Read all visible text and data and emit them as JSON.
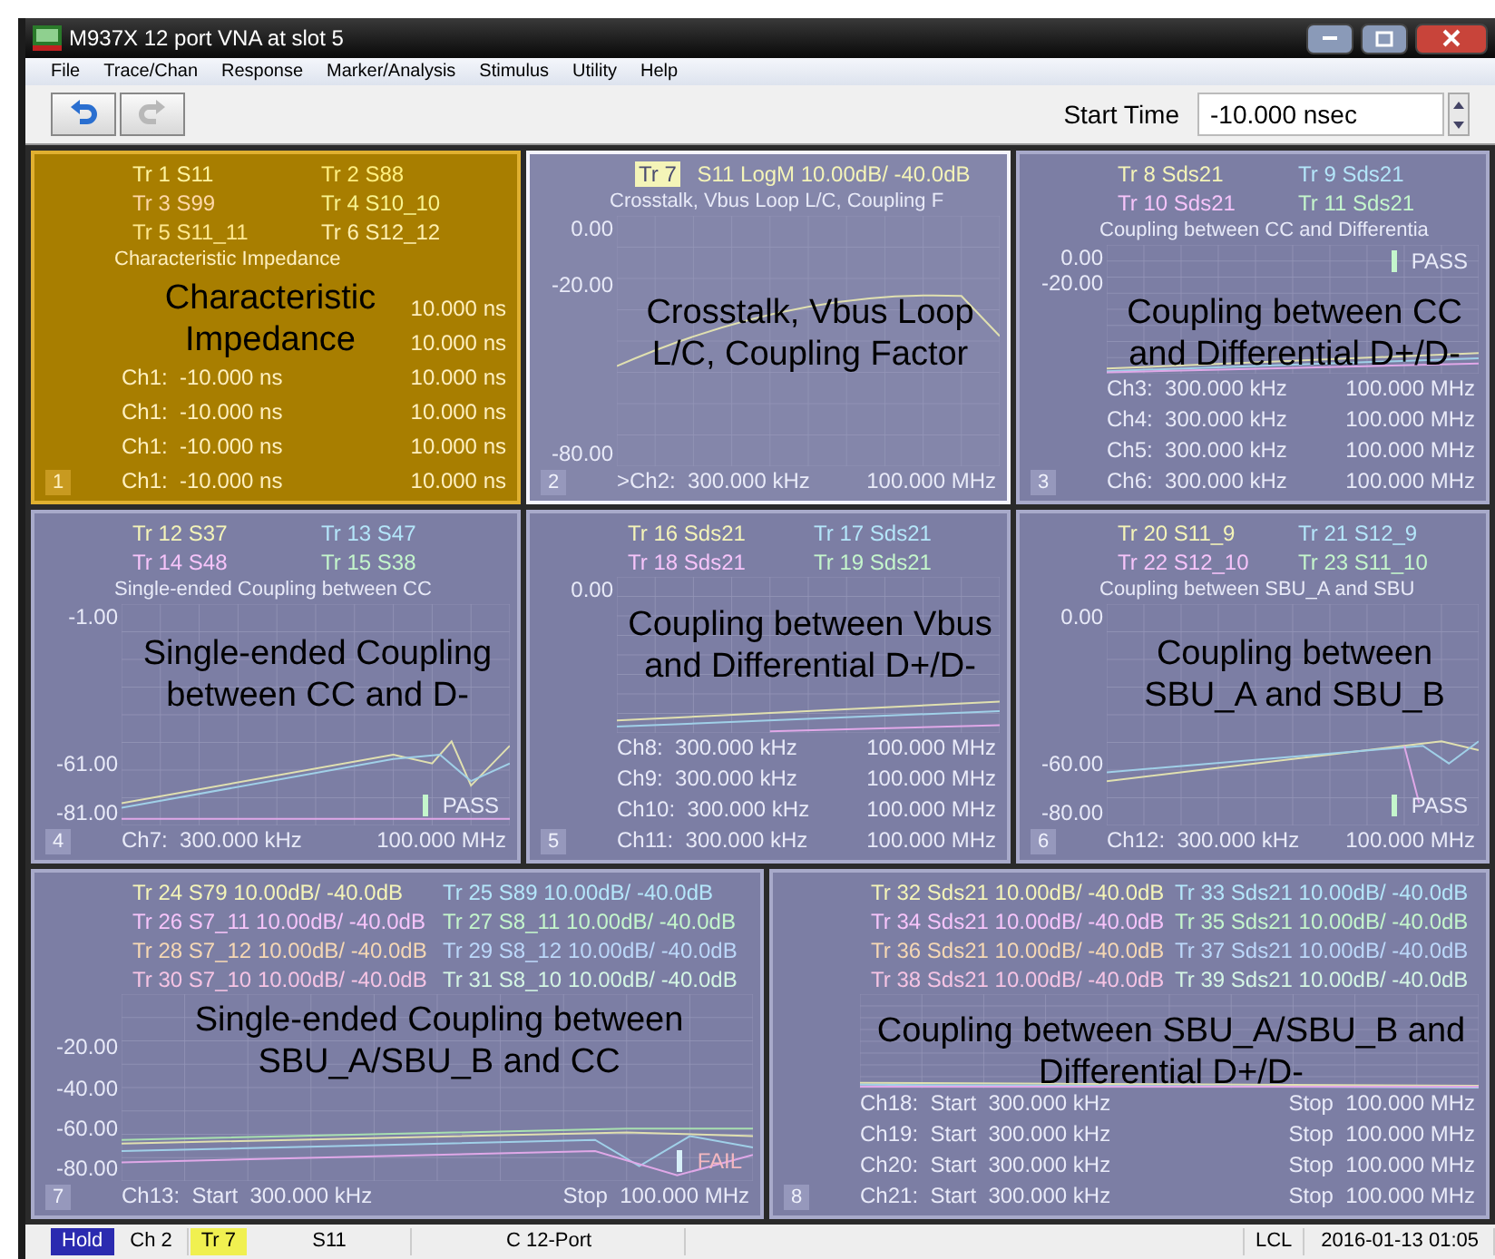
{
  "window": {
    "title": "M937X 12 port VNA at slot 5"
  },
  "menu": [
    "File",
    "Trace/Chan",
    "Response",
    "Marker/Analysis",
    "Stimulus",
    "Utility",
    "Help"
  ],
  "toolbar": {
    "undo": {
      "disabled": false
    },
    "redo": {
      "disabled": true
    },
    "start_time": {
      "label": "Start Time",
      "value": "-10.000 nsec"
    }
  },
  "panels": [
    {
      "number": "1",
      "selected": true,
      "active": false,
      "caption": "Characteristic Impedance",
      "title": "Characteristic Impedance",
      "traces": [
        {
          "label": "Tr 1",
          "param": "S11",
          "color": "#fff4a0"
        },
        {
          "label": "Tr 2",
          "param": "S88",
          "color": "#fff080"
        },
        {
          "label": "Tr 3",
          "param": "S99",
          "color": "#ffd8a8"
        },
        {
          "label": "Tr 4",
          "param": "S10_10",
          "color": "#f8f490"
        },
        {
          "label": "Tr 5",
          "param": "S11_11",
          "color": "#ffe890"
        },
        {
          "label": "Tr 6",
          "param": "S12_12",
          "color": "#fff0b0"
        }
      ],
      "channels": [
        {
          "stop": "10.000 ns"
        },
        {
          "stop": "10.000 ns"
        },
        {
          "start": "Ch1:  -10.000 ns",
          "stop": "10.000 ns"
        },
        {
          "start": "Ch1:  -10.000 ns",
          "stop": "10.000 ns"
        },
        {
          "start": "Ch1:  -10.000 ns",
          "stop": "10.000 ns"
        },
        {
          "start": "Ch1:  -10.000 ns",
          "stop": "10.000 ns"
        }
      ]
    },
    {
      "number": "2",
      "selected": false,
      "active": true,
      "caption": "Crosstalk, Vbus Loop L/C, Coupling Factor",
      "title": "Crosstalk, Vbus Loop L/C, Coupling F",
      "traces": [
        {
          "label": "Tr 7",
          "param": "S11 LogM 10.00dB/ -40.0dB",
          "color": "#f4f4b8",
          "active": true
        }
      ],
      "y_ticks": [
        "0.00",
        "-20.00",
        "-80.00"
      ],
      "channels": [
        {
          "start": ">Ch2:  300.000 kHz",
          "stop": "100.000 MHz"
        }
      ]
    },
    {
      "number": "3",
      "selected": false,
      "active": false,
      "caption": "Coupling between CC and Differential D+/D-",
      "title": "Coupling between CC and Differentia",
      "traces": [
        {
          "label": "Tr 8",
          "param": "Sds21",
          "color": "#f4f4b8"
        },
        {
          "label": "Tr 9",
          "param": "Sds21",
          "color": "#b4e6fa"
        },
        {
          "label": "Tr 10",
          "param": "Sds21",
          "color": "#f6c4fa"
        },
        {
          "label": "Tr 11",
          "param": "Sds21",
          "color": "#c4f6cc"
        }
      ],
      "y_ticks": [
        "0.00",
        "-20.00"
      ],
      "limit": {
        "kind": "pass",
        "text": "PASS"
      },
      "channels": [
        {
          "start": "Ch3:  300.000 kHz",
          "stop": "100.000 MHz"
        },
        {
          "start": "Ch4:  300.000 kHz",
          "stop": "100.000 MHz"
        },
        {
          "start": "Ch5:  300.000 kHz",
          "stop": "100.000 MHz"
        },
        {
          "start": "Ch6:  300.000 kHz",
          "stop": "100.000 MHz"
        }
      ]
    },
    {
      "number": "4",
      "selected": false,
      "active": false,
      "caption": "Single-ended Coupling between CC and D-",
      "title": "Single-ended Coupling between CC",
      "traces": [
        {
          "label": "Tr 12",
          "param": "S37",
          "color": "#f4f4b8"
        },
        {
          "label": "Tr 13",
          "param": "S47",
          "color": "#b4e6fa"
        },
        {
          "label": "Tr 14",
          "param": "S48",
          "color": "#f6c4fa"
        },
        {
          "label": "Tr 15",
          "param": "S38",
          "color": "#c4f6cc"
        }
      ],
      "y_ticks": [
        "-1.00",
        "-61.00",
        "-81.00"
      ],
      "limit": {
        "kind": "pass",
        "text": "PASS"
      },
      "channels": [
        {
          "start": "Ch7:  300.000 kHz",
          "stop": "100.000 MHz"
        }
      ]
    },
    {
      "number": "5",
      "selected": false,
      "active": false,
      "caption": "Coupling between Vbus and Differential D+/D-",
      "traces": [
        {
          "label": "Tr 16",
          "param": "Sds21",
          "color": "#f4f4b8"
        },
        {
          "label": "Tr 17",
          "param": "Sds21",
          "color": "#b4e6fa"
        },
        {
          "label": "Tr 18",
          "param": "Sds21",
          "color": "#f6c4fa"
        },
        {
          "label": "Tr 19",
          "param": "Sds21",
          "color": "#c4f6cc"
        }
      ],
      "y_ticks": [
        "0.00"
      ],
      "channels": [
        {
          "start": "Ch8:  300.000 kHz",
          "stop": "100.000 MHz"
        },
        {
          "start": "Ch9:  300.000 kHz",
          "stop": "100.000 MHz"
        },
        {
          "start": "Ch10:  300.000 kHz",
          "stop": "100.000 MHz"
        },
        {
          "start": "Ch11:  300.000 kHz",
          "stop": "100.000 MHz"
        }
      ]
    },
    {
      "number": "6",
      "selected": false,
      "active": false,
      "caption": "Coupling between SBU_A and SBU_B",
      "title": "Coupling between SBU_A and SBU",
      "traces": [
        {
          "label": "Tr 20",
          "param": "S11_9",
          "color": "#f4f4b8"
        },
        {
          "label": "Tr 21",
          "param": "S12_9",
          "color": "#b4e6fa"
        },
        {
          "label": "Tr 22",
          "param": "S12_10",
          "color": "#f6c4fa"
        },
        {
          "label": "Tr 23",
          "param": "S11_10",
          "color": "#c4f6cc"
        }
      ],
      "y_ticks": [
        "0.00",
        "-60.00",
        "-80.00"
      ],
      "limit": {
        "kind": "pass",
        "text": "PASS"
      },
      "channels": [
        {
          "start": "Ch12:  300.000 kHz",
          "stop": "100.000 MHz"
        }
      ]
    },
    {
      "number": "7",
      "selected": false,
      "active": false,
      "caption": "Single-ended Coupling between SBU_A/SBU_B and CC",
      "traces": [
        {
          "label": "Tr 24",
          "param": "S79 10.00dB/ -40.0dB",
          "color": "#f4f4b8"
        },
        {
          "label": "Tr 25",
          "param": "S89 10.00dB/ -40.0dB",
          "color": "#b4e6fa"
        },
        {
          "label": "Tr 26",
          "param": "S7_11 10.00dB/ -40.0dB",
          "color": "#f6c4fa"
        },
        {
          "label": "Tr 27",
          "param": "S8_11 10.00dB/ -40.0dB",
          "color": "#c4f6cc"
        },
        {
          "label": "Tr 28",
          "param": "S7_12 10.00dB/ -40.0dB",
          "color": "#f6d8b4"
        },
        {
          "label": "Tr 29",
          "param": "S8_12 10.00dB/ -40.0dB",
          "color": "#bcd8fa"
        },
        {
          "label": "Tr 30",
          "param": "S7_10 10.00dB/ -40.0dB",
          "color": "#f6c4e4"
        },
        {
          "label": "Tr 31",
          "param": "S8_10 10.00dB/ -40.0dB",
          "color": "#d4f6e4"
        }
      ],
      "y_ticks": [
        "-20.00",
        "-40.00",
        "-60.00",
        "-80.00"
      ],
      "limit": {
        "kind": "fail",
        "text": "FAIL"
      },
      "channels": [
        {
          "start": "Ch13:  Start  300.000 kHz",
          "stop": "Stop  100.000 MHz"
        }
      ]
    },
    {
      "number": "8",
      "selected": false,
      "active": false,
      "caption": "Coupling between SBU_A/SBU_B and Differential D+/D-",
      "traces": [
        {
          "label": "Tr 32",
          "param": "Sds21 10.00dB/ -40.0dB",
          "color": "#f4f4b8"
        },
        {
          "label": "Tr 33",
          "param": "Sds21 10.00dB/ -40.0dB",
          "color": "#b4e6fa"
        },
        {
          "label": "Tr 34",
          "param": "Sds21 10.00dB/ -40.0dB",
          "color": "#f6c4fa"
        },
        {
          "label": "Tr 35",
          "param": "Sds21 10.00dB/ -40.0dB",
          "color": "#c4f6cc"
        },
        {
          "label": "Tr 36",
          "param": "Sds21 10.00dB/ -40.0dB",
          "color": "#f6d8b4"
        },
        {
          "label": "Tr 37",
          "param": "Sds21 10.00dB/ -40.0dB",
          "color": "#bcd8fa"
        },
        {
          "label": "Tr 38",
          "param": "Sds21 10.00dB/ -40.0dB",
          "color": "#f6c4e4"
        },
        {
          "label": "Tr 39",
          "param": "Sds21 10.00dB/ -40.0dB",
          "color": "#d4f6e4"
        }
      ],
      "channels": [
        {
          "start": "Ch18:  Start  300.000 kHz",
          "stop": "Stop  100.000 MHz"
        },
        {
          "start": "Ch19:  Start  300.000 kHz",
          "stop": "Stop  100.000 MHz"
        },
        {
          "start": "Ch20:  Start  300.000 kHz",
          "stop": "Stop  100.000 MHz"
        },
        {
          "start": "Ch21:  Start  300.000 kHz",
          "stop": "Stop  100.000 MHz"
        }
      ]
    }
  ],
  "status_bar": [
    {
      "kind": "hold",
      "text": "Hold"
    },
    {
      "kind": "plain",
      "text": "Ch 2"
    },
    {
      "kind": "trace",
      "text": "Tr 7"
    },
    {
      "kind": "plain",
      "text": "S11"
    },
    {
      "kind": "plain",
      "text": "C  12-Port"
    },
    {
      "kind": "spacer",
      "text": "LCL"
    },
    {
      "kind": "plain",
      "text": "2016-01-13 01:05"
    }
  ]
}
